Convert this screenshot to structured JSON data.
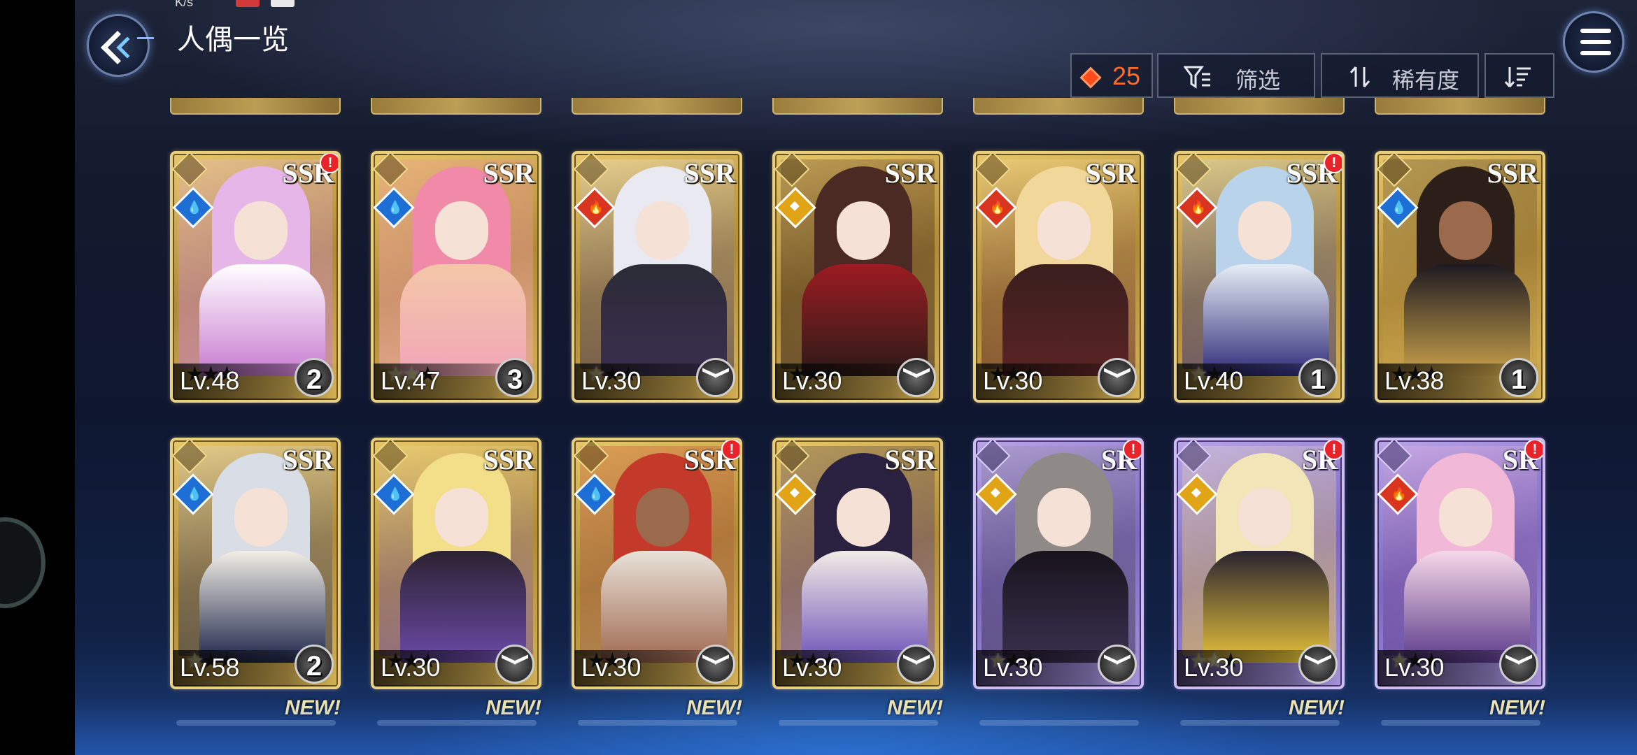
{
  "status": {
    "speed": "K/s"
  },
  "header": {
    "title": "人偶一览"
  },
  "toolbar": {
    "count": "25",
    "filter_label": "筛选",
    "sort_label": "稀有度",
    "icons": {
      "count": "gem-icon",
      "filter": "filter-icon",
      "sort": "sort-icon",
      "order": "sort-order-icon"
    }
  },
  "colors": {
    "ssr_frame": "#d9b55a",
    "sr_frame": "#9c87d6",
    "accent": "#ff6a2a",
    "alert": "#e8232a"
  },
  "cards": [
    {
      "rarity": "SSR",
      "level": "Lv.48",
      "element": "water",
      "stars": 0,
      "badge": "2",
      "alert": "!",
      "new": ""
    },
    {
      "rarity": "SSR",
      "level": "Lv.47",
      "element": "water",
      "stars": 2,
      "badge": "3",
      "alert": "",
      "new": ""
    },
    {
      "rarity": "SSR",
      "level": "Lv.30",
      "element": "fire",
      "stars": 1,
      "badge": "",
      "alert": "",
      "new": ""
    },
    {
      "rarity": "SSR",
      "level": "Lv.30",
      "element": "light",
      "stars": 0,
      "badge": "",
      "alert": "",
      "new": ""
    },
    {
      "rarity": "SSR",
      "level": "Lv.30",
      "element": "fire",
      "stars": 0,
      "badge": "",
      "alert": "",
      "new": ""
    },
    {
      "rarity": "SSR",
      "level": "Lv.40",
      "element": "fire",
      "stars": 1,
      "badge": "1",
      "alert": "!",
      "new": ""
    },
    {
      "rarity": "SSR",
      "level": "Lv.38",
      "element": "water",
      "stars": 0,
      "badge": "1",
      "alert": "",
      "new": ""
    },
    {
      "rarity": "SSR",
      "level": "Lv.58",
      "element": "water",
      "stars": 1,
      "badge": "2",
      "alert": "",
      "new": "NEW!"
    },
    {
      "rarity": "SSR",
      "level": "Lv.30",
      "element": "water",
      "stars": 0,
      "badge": "",
      "alert": "",
      "new": "NEW!"
    },
    {
      "rarity": "SSR",
      "level": "Lv.30",
      "element": "water",
      "stars": 0,
      "badge": "",
      "alert": "!",
      "new": "NEW!"
    },
    {
      "rarity": "SSR",
      "level": "Lv.30",
      "element": "light",
      "stars": 0,
      "badge": "",
      "alert": "",
      "new": "NEW!"
    },
    {
      "rarity": "SR",
      "level": "Lv.30",
      "element": "light",
      "stars": 1,
      "badge": "",
      "alert": "!",
      "new": ""
    },
    {
      "rarity": "SR",
      "level": "Lv.30",
      "element": "light",
      "stars": 2,
      "badge": "",
      "alert": "!",
      "new": "NEW!"
    },
    {
      "rarity": "SR",
      "level": "Lv.30",
      "element": "fire",
      "stars": 1,
      "badge": "",
      "alert": "!",
      "new": "NEW!"
    }
  ]
}
